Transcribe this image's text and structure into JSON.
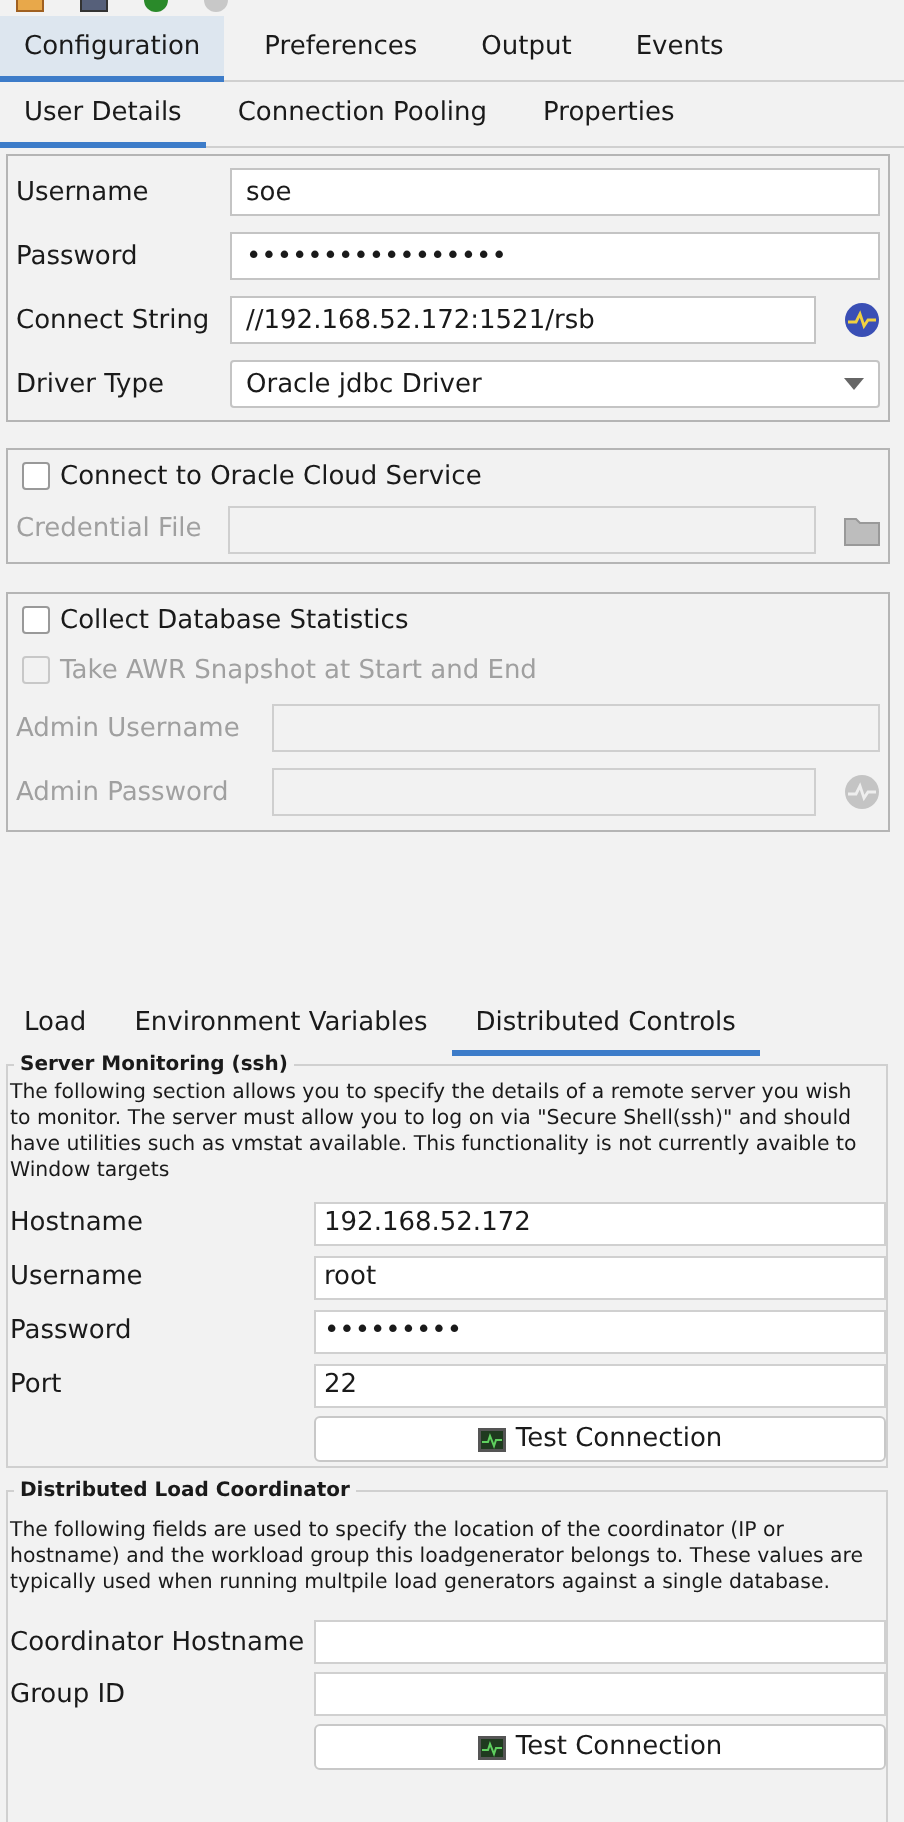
{
  "main_tabs": [
    {
      "label": "Configuration",
      "selected": true
    },
    {
      "label": "Preferences",
      "selected": false
    },
    {
      "label": "Output",
      "selected": false
    },
    {
      "label": "Events",
      "selected": false
    }
  ],
  "sub_tabs": [
    {
      "label": "User Details",
      "selected": true
    },
    {
      "label": "Connection Pooling",
      "selected": false
    },
    {
      "label": "Properties",
      "selected": false
    }
  ],
  "connection": {
    "fields": [
      {
        "label": "Username",
        "value": "soe",
        "kind": "field"
      },
      {
        "label": "Password",
        "value": "•••••••••••••••••",
        "kind": "field"
      },
      {
        "label": "Connect String",
        "value": "//192.168.52.172:1521/rsb",
        "kind": "field_button"
      },
      {
        "label": "Driver Type",
        "value": "Oracle jdbc Driver",
        "kind": "dropdown"
      }
    ]
  },
  "cloud": {
    "checkbox": {
      "label": "Connect to Oracle Cloud Service",
      "checked": false,
      "disabled": false
    },
    "fields": [
      {
        "label": "Credential File",
        "kind": "field_folder",
        "disabled": true
      }
    ]
  },
  "stats": {
    "checkbox": {
      "label": "Collect Database Statistics",
      "checked": false,
      "disabled": false
    },
    "snapshot": {
      "label": "Take AWR Snapshot at Start and End",
      "checked": false,
      "disabled": true
    },
    "fields": [
      {
        "label": "Admin Username",
        "kind": "field",
        "disabled": true
      },
      {
        "label": "Admin Password",
        "kind": "field_button",
        "disabled": true
      }
    ]
  },
  "lower_tabs": [
    {
      "label": "Load",
      "selected": false
    },
    {
      "label": "Environment Variables",
      "selected": false
    },
    {
      "label": "Distributed Controls",
      "selected": true
    }
  ],
  "server_monitoring": {
    "title": "Server Monitoring (ssh)",
    "description": "The following section allows you to specify the details of a remote server you wish to monitor. The server must allow you to log on via \"Secure Shell(ssh)\" and should have utilities such as vmstat available. This functionality is not currently avaible to Window targets",
    "fields": [
      {
        "label": "Hostname",
        "value": "192.168.52.172"
      },
      {
        "label": "Username",
        "value": "root"
      },
      {
        "label": "Password",
        "value": "•••••••••"
      },
      {
        "label": "Port",
        "value": "22"
      }
    ],
    "button": "Test Connection"
  },
  "coordinator": {
    "title": "Distributed Load Coordinator",
    "description": "The following fields are used to specify the location of the coordinator (IP or hostname) and the workload group this loadgenerator belongs to. These values are typically used when running multpile load generators against a single database.",
    "fields": [
      {
        "label": "Coordinator Hostname"
      },
      {
        "label": "Group ID"
      }
    ],
    "button": "Test Connection"
  }
}
